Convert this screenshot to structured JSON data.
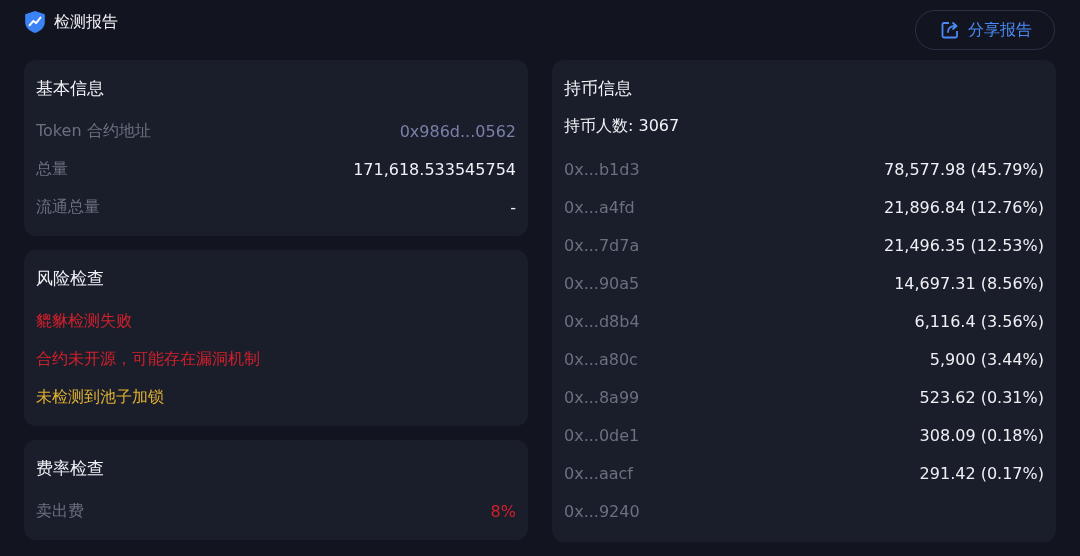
{
  "header": {
    "title": "检测报告",
    "share_button": "分享报告"
  },
  "basic_info": {
    "title": "基本信息",
    "rows": [
      {
        "label": "Token 合约地址",
        "value": "0x986d...0562",
        "kind": "address"
      },
      {
        "label": "总量",
        "value": "171,618.533545754",
        "kind": "number"
      },
      {
        "label": "流通总量",
        "value": "-",
        "kind": "number"
      }
    ]
  },
  "risk_check": {
    "title": "风险检查",
    "items": [
      {
        "text": "貔貅检测失败",
        "kind": "danger"
      },
      {
        "text": "合约未开源，可能存在漏洞机制",
        "kind": "danger"
      },
      {
        "text": "未检测到池子加锁",
        "kind": "warning"
      }
    ]
  },
  "fee_check": {
    "title": "费率检查",
    "rows": [
      {
        "label": "卖出费",
        "value": "8%",
        "kind": "danger"
      }
    ]
  },
  "holders": {
    "title": "持币信息",
    "count": "持币人数: 3067",
    "rows": [
      {
        "address": "0x...b1d3",
        "value": "78,577.98 (45.79%)"
      },
      {
        "address": "0x...a4fd",
        "value": "21,896.84 (12.76%)"
      },
      {
        "address": "0x...7d7a",
        "value": "21,496.35 (12.53%)"
      },
      {
        "address": "0x...90a5",
        "value": "14,697.31 (8.56%)"
      },
      {
        "address": "0x...d8b4",
        "value": "6,116.4 (3.56%)"
      },
      {
        "address": "0x...a80c",
        "value": "5,900 (3.44%)"
      },
      {
        "address": "0x...8a99",
        "value": "523.62 (0.31%)"
      },
      {
        "address": "0x...0de1",
        "value": "308.09 (0.18%)"
      },
      {
        "address": "0x...aacf",
        "value": "291.42 (0.17%)"
      },
      {
        "address": "0x...9240"
      }
    ]
  }
}
